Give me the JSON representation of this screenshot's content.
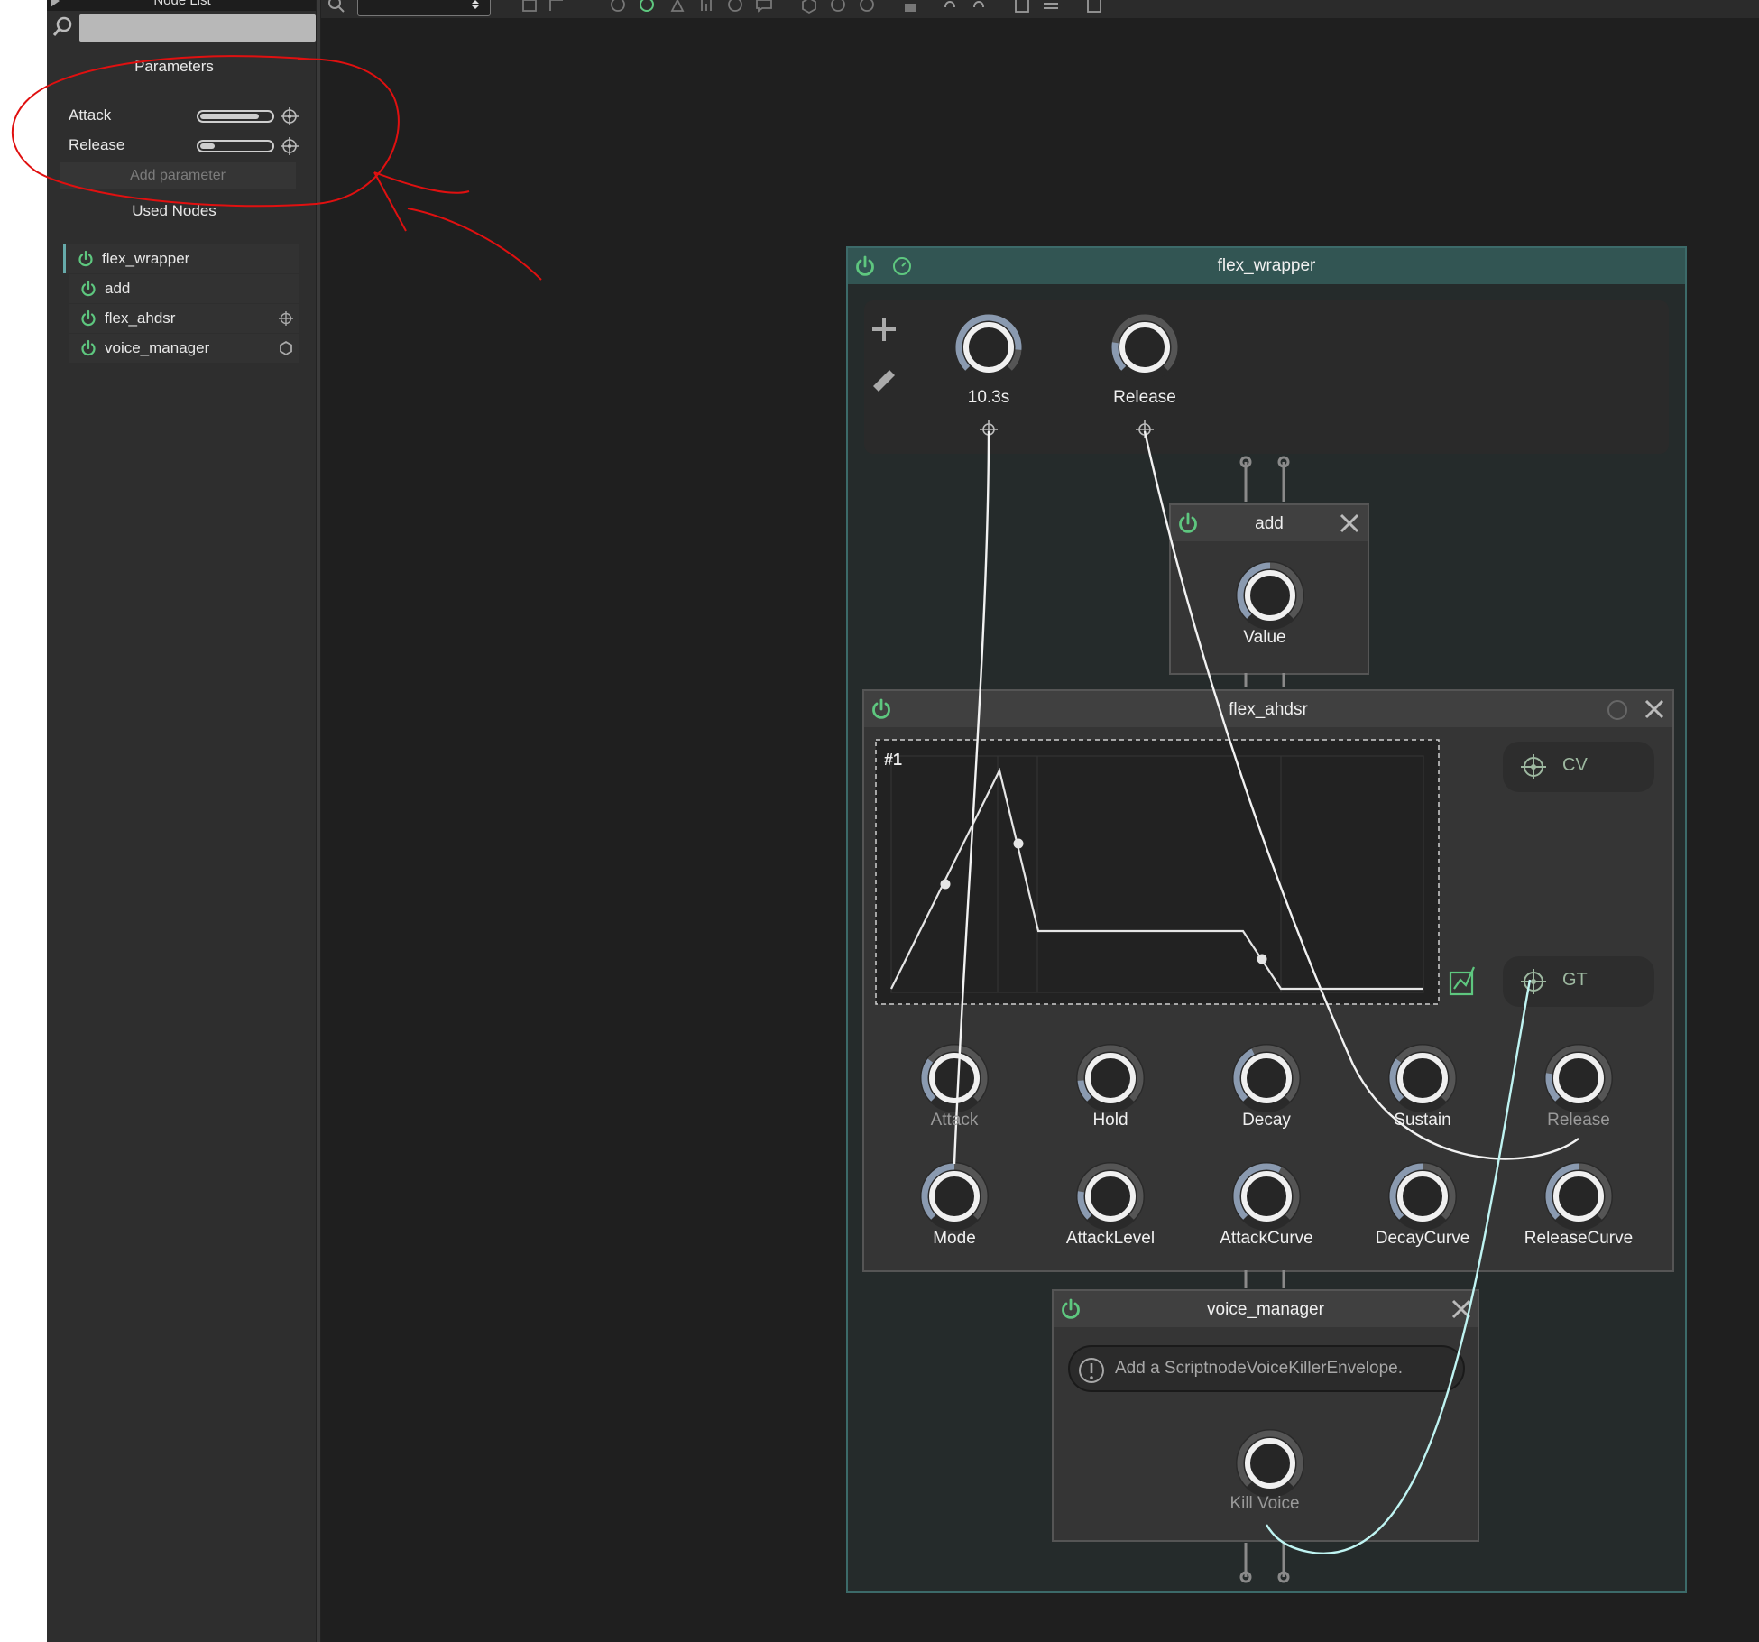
{
  "sidebar": {
    "header_title": "Node List",
    "search_placeholder": "",
    "parameters_heading": "Parameters",
    "parameters": [
      {
        "label": "Attack",
        "value": 0.85
      },
      {
        "label": "Release",
        "value": 0.2
      }
    ],
    "add_parameter": "Add parameter",
    "used_nodes_heading": "Used Nodes",
    "nodes": [
      {
        "label": "flex_wrapper",
        "tail_icon": ""
      },
      {
        "label": "add",
        "tail_icon": ""
      },
      {
        "label": "flex_ahdsr",
        "tail_icon": "target-icon"
      },
      {
        "label": "voice_manager",
        "tail_icon": "hexagon-icon"
      }
    ]
  },
  "colors": {
    "power_green": "#5ec77f",
    "wire_white": "#f2f2f2",
    "wire_cyan": "#bff4f2",
    "annotation_red": "#e01010",
    "wrapper_border": "#3c6a69"
  },
  "wrapper": {
    "title": "flex_wrapper",
    "knobs": [
      {
        "label": "10.3s",
        "value": 0.85
      },
      {
        "label": "Release",
        "value": 0.2
      }
    ]
  },
  "add_node": {
    "title": "add",
    "knob_label": "Value"
  },
  "ahdsr": {
    "title": "flex_ahdsr",
    "graph_label": "#1",
    "cv_label": "CV",
    "gt_label": "GT",
    "knobs_row1": [
      "Attack",
      "Hold",
      "Decay",
      "Sustain",
      "Release"
    ],
    "knobs_row2": [
      "Mode",
      "AttackLevel",
      "AttackCurve",
      "DecayCurve",
      "ReleaseCurve"
    ]
  },
  "voice_manager": {
    "title": "voice_manager",
    "warning": "Add a ScriptnodeVoiceKillerEnvelope.",
    "knob_label": "Kill Voice"
  }
}
